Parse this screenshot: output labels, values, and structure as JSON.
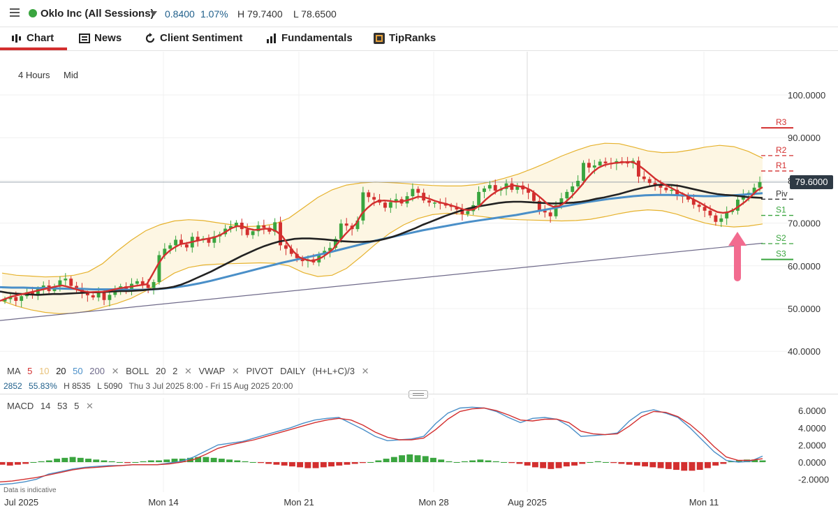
{
  "header": {
    "title": "Oklo Inc (All Sessions)",
    "change": "0.8400",
    "change_pct": "1.07%",
    "high": "H 79.7400",
    "low": "L 78.6500",
    "status_color": "#3aa53f"
  },
  "tabs": [
    {
      "label": "Chart",
      "icon": "candlestick-chart-icon"
    },
    {
      "label": "News",
      "icon": "news-icon"
    },
    {
      "label": "Client Sentiment",
      "icon": "refresh-icon"
    },
    {
      "label": "Fundamentals",
      "icon": "bar-chart-icon"
    },
    {
      "label": "TipRanks",
      "icon": "tipranks-icon"
    }
  ],
  "timeframe": {
    "interval": "4 Hours",
    "price_type": "Mid"
  },
  "legend": {
    "ma_label": "MA",
    "ma_periods": [
      "5",
      "10",
      "20",
      "50",
      "200"
    ],
    "boll_label": "BOLL",
    "boll_period": "20",
    "boll_dev": "2",
    "vwap_label": "VWAP",
    "pivot_label": "PIVOT",
    "pivot_type": "DAILY",
    "pivot_formula": "(H+L+C)/3",
    "close_x": "✕"
  },
  "stats": {
    "value": "2852",
    "pct": "55.83%",
    "high": "H 8535",
    "low": "L 5090",
    "range": "Thu 3 Jul 2025 8:00 - Fri 15 Aug 2025 20:00"
  },
  "macd_legend": {
    "label": "MACD",
    "fast": "14",
    "slow": "53",
    "signal": "5"
  },
  "disclaimer": "Data is indicative",
  "colors": {
    "up": "#3aa53f",
    "down": "#d32f2f",
    "ma5": "#d32f2f",
    "ma10": "#e8c27a",
    "ma20": "#222222",
    "ma50": "#4a8fc8",
    "ma200": "#6f6a8a",
    "boll": "#e6b22d",
    "price": "#1f5f8b"
  },
  "chart_data": [
    {
      "type": "candlestick",
      "title": "",
      "ylim": [
        35,
        105
      ],
      "yticks": [
        40,
        50,
        60,
        70,
        80,
        90,
        100
      ],
      "ytick_labels": [
        "40.0000",
        "50.0000",
        "60.0000",
        "70.0000",
        "80.0000",
        "90.0000",
        "100.0000"
      ],
      "x_labels": [
        "Jul 2025",
        "Mon 14",
        "Mon 21",
        "Mon 28",
        "Aug 2025",
        "Mon 11"
      ],
      "last_price": 79.6,
      "last_price_label": "79.6000",
      "close": [
        52.2,
        52.7,
        51.8,
        52.9,
        53.8,
        53.2,
        54.6,
        55.4,
        54.1,
        55.2,
        56.6,
        57.0,
        55.3,
        54.7,
        53.6,
        53.1,
        52.6,
        53.7,
        52.0,
        53.2,
        54.1,
        55.2,
        54.6,
        55.8,
        56.4,
        55.6,
        54.8,
        56.2,
        62.5,
        64.0,
        64.8,
        66.1,
        65.0,
        64.3,
        66.8,
        66.0,
        66.4,
        65.4,
        66.9,
        67.4,
        68.7,
        69.3,
        70.1,
        68.6,
        67.2,
        68.1,
        69.5,
        68.9,
        68.0,
        70.2,
        64.8,
        64.0,
        62.8,
        61.8,
        61.1,
        61.5,
        60.8,
        62.7,
        63.5,
        64.2,
        66.3,
        69.9,
        69.4,
        68.6,
        70.6,
        77.2,
        76.1,
        75.5,
        74.8,
        73.6,
        74.9,
        75.6,
        74.6,
        76.3,
        78.0,
        77.1,
        75.3,
        74.8,
        74.8,
        74.7,
        74.1,
        73.8,
        73.2,
        72.1,
        72.8,
        74.2,
        77.3,
        78.1,
        78.9,
        77.6,
        78.0,
        79.3,
        77.8,
        78.8,
        77.9,
        77.1,
        75.2,
        72.9,
        72.5,
        71.6,
        74.2,
        75.8,
        77.3,
        78.6,
        79.9,
        84.1,
        83.0,
        83.5,
        84.4,
        84.0,
        83.9,
        84.5,
        84.2,
        84.0,
        84.6,
        80.9,
        80.3,
        79.4,
        78.8,
        78.3,
        77.7,
        77.8,
        76.6,
        76.2,
        75.5,
        74.3,
        73.8,
        72.9,
        71.8,
        70.3,
        71.1,
        72.6,
        72.9,
        75.5,
        76.6,
        77.1,
        78.3,
        79.6
      ],
      "ma5": [
        51.8,
        52.3,
        52.8,
        53.1,
        53.4,
        53.7,
        54.0,
        54.3,
        54.6,
        54.9,
        55.2,
        55.4,
        55.1,
        54.7,
        54.3,
        54.0,
        53.8,
        53.9,
        53.9,
        54.1,
        54.4,
        54.7,
        54.9,
        55.1,
        55.3,
        55.5,
        55.7,
        58.0,
        60.4,
        62.3,
        63.5,
        64.4,
        65.1,
        65.3,
        65.6,
        65.9,
        66.2,
        66.4,
        66.7,
        67.2,
        68.0,
        68.8,
        69.3,
        69.2,
        68.7,
        68.4,
        68.5,
        68.7,
        68.6,
        68.0,
        66.9,
        65.0,
        63.3,
        62.0,
        61.5,
        61.2,
        61.4,
        62.0,
        62.9,
        64.0,
        65.6,
        67.2,
        68.6,
        69.8,
        72.1,
        73.5,
        74.6,
        75.2,
        75.3,
        75.2,
        75.0,
        75.1,
        75.3,
        75.7,
        76.2,
        76.1,
        75.7,
        75.2,
        74.8,
        74.5,
        74.1,
        73.7,
        73.2,
        73.0,
        73.3,
        74.2,
        75.5,
        76.6,
        77.5,
        78.1,
        78.6,
        78.8,
        78.6,
        78.3,
        77.7,
        76.7,
        75.6,
        74.4,
        73.8,
        74.0,
        74.8,
        76.0,
        77.4,
        78.9,
        80.6,
        82.0,
        83.0,
        83.6,
        83.9,
        84.1,
        84.2,
        84.3,
        84.3,
        83.6,
        82.6,
        81.5,
        80.4,
        79.5,
        78.8,
        78.1,
        77.4,
        76.8,
        76.1,
        75.4,
        74.7,
        73.9,
        73.2,
        72.6,
        72.4,
        72.6,
        73.2,
        74.1,
        75.1,
        76.3,
        77.6,
        78.4
      ],
      "ma20": [
        54.0,
        53.7,
        53.5,
        53.4,
        53.3,
        53.2,
        53.3,
        53.4,
        53.4,
        53.5,
        53.6,
        53.7,
        53.8,
        53.8,
        53.9,
        54.0,
        54.1,
        54.1,
        54.2,
        54.3,
        54.5,
        54.6,
        54.8,
        55.1,
        55.6,
        56.3,
        57.1,
        57.9,
        58.7,
        59.6,
        60.5,
        61.4,
        62.3,
        63.1,
        63.9,
        64.6,
        65.2,
        65.7,
        66.0,
        66.3,
        66.4,
        66.4,
        66.3,
        66.2,
        66.0,
        65.8,
        65.7,
        65.6,
        65.6,
        65.7,
        65.9,
        66.3,
        66.8,
        67.4,
        68.1,
        68.8,
        69.6,
        70.3,
        71.0,
        71.7,
        72.3,
        72.9,
        73.4,
        73.8,
        74.1,
        74.4,
        74.7,
        74.9,
        75.0,
        75.0,
        74.9,
        74.8,
        74.7,
        74.6,
        74.6,
        74.7,
        74.8,
        75.0,
        75.3,
        75.7,
        76.0,
        76.4,
        76.8,
        77.3,
        77.8,
        78.2,
        78.6,
        78.9,
        79.0,
        78.9,
        78.7,
        78.3,
        77.9,
        77.5,
        77.1,
        76.8,
        76.6,
        76.5,
        76.3,
        76.1,
        76.0,
        75.9
      ],
      "ma50": [
        55.0,
        54.9,
        54.9,
        54.8,
        54.8,
        54.7,
        54.6,
        54.6,
        54.5,
        54.5,
        54.5,
        54.4,
        54.4,
        54.5,
        54.7,
        55.0,
        55.4,
        55.9,
        56.5,
        57.2,
        57.9,
        58.6,
        59.3,
        60.0,
        60.7,
        61.3,
        61.9,
        62.5,
        63.1,
        63.8,
        64.5,
        65.2,
        65.9,
        66.5,
        67.1,
        67.7,
        68.3,
        68.8,
        69.3,
        69.8,
        70.3,
        70.7,
        71.1,
        71.5,
        71.9,
        72.4,
        72.9,
        73.4,
        73.9,
        74.4,
        74.9,
        75.3,
        75.7,
        76.0,
        76.3,
        76.5,
        76.6,
        76.6,
        76.5,
        76.4,
        76.3,
        76.3,
        76.4,
        76.6,
        76.8,
        77.0
      ],
      "ma200": [
        47.2,
        65.3
      ],
      "boll_upper": [
        58.3,
        57.8,
        57.6,
        57.4,
        57.5,
        57.8,
        58.6,
        60.5,
        63.4,
        66.0,
        68.2,
        69.6,
        70.5,
        70.8,
        70.6,
        70.1,
        69.6,
        69.2,
        69.3,
        69.8,
        71.2,
        73.6,
        76.0,
        77.8,
        78.9,
        79.4,
        79.6,
        79.5,
        79.3,
        79.0,
        78.8,
        78.7,
        78.7,
        79.0,
        79.6,
        80.5,
        81.5,
        82.8,
        84.2,
        85.7,
        87.0,
        88.1,
        88.7,
        88.6,
        87.8,
        86.9,
        86.5,
        86.6,
        87.1,
        87.8,
        88.2,
        87.9,
        86.8,
        85.2
      ],
      "boll_lower": [
        51.8,
        50.6,
        49.7,
        49.1,
        48.8,
        48.9,
        49.4,
        50.3,
        51.2,
        52.4,
        54.1,
        56.2,
        58.3,
        59.6,
        60.2,
        60.4,
        60.5,
        60.6,
        60.7,
        60.6,
        60.0,
        58.4,
        57.5,
        57.8,
        59.4,
        62.1,
        65.0,
        67.6,
        69.6,
        71.1,
        72.0,
        72.3,
        72.1,
        71.7,
        71.3,
        71.0,
        70.8,
        70.7,
        70.6,
        70.5,
        70.6,
        70.9,
        71.5,
        72.2,
        72.8,
        73.1,
        72.9,
        72.1,
        71.0,
        70.0,
        69.4,
        69.1,
        69.3,
        69.8
      ],
      "pivot_levels": [
        {
          "label": "R3",
          "value": 92.3
        },
        {
          "label": "R2",
          "value": 85.8
        },
        {
          "label": "R1",
          "value": 82.2
        },
        {
          "label": "Piv",
          "value": 75.6
        },
        {
          "label": "S1",
          "value": 71.8
        },
        {
          "label": "S2",
          "value": 65.2
        },
        {
          "label": "S3",
          "value": 61.5
        }
      ]
    },
    {
      "type": "bar",
      "title": "MACD",
      "ylim": [
        -3,
        7
      ],
      "yticks": [
        -2,
        0,
        2,
        4,
        6
      ],
      "ytick_labels": [
        "-2.0000",
        "0.0000",
        "2.0000",
        "4.0000",
        "6.0000"
      ],
      "macd": [
        -2.6,
        -2.5,
        -2.3,
        -2.0,
        -1.4,
        -1.1,
        -0.8,
        -0.6,
        -0.5,
        -0.4,
        -0.4,
        -0.3,
        -0.3,
        -0.3,
        -0.1,
        0.1,
        0.6,
        1.3,
        2.0,
        2.2,
        2.4,
        2.8,
        3.2,
        3.6,
        4.0,
        4.5,
        4.9,
        5.1,
        5.2,
        4.5,
        3.8,
        3.0,
        2.5,
        2.6,
        2.7,
        3.0,
        4.5,
        5.7,
        6.3,
        6.4,
        6.3,
        5.9,
        5.2,
        4.6,
        5.1,
        5.2,
        5.0,
        4.2,
        3.0,
        3.1,
        3.2,
        3.4,
        4.8,
        5.8,
        6.1,
        5.7,
        5.2,
        4.0,
        2.6,
        1.2,
        0.2,
        0.0,
        0.1,
        0.7
      ],
      "signal": [
        -2.3,
        -2.2,
        -2.0,
        -1.8,
        -1.5,
        -1.2,
        -0.9,
        -0.7,
        -0.6,
        -0.5,
        -0.4,
        -0.3,
        -0.3,
        -0.3,
        -0.2,
        0.0,
        0.3,
        0.9,
        1.6,
        2.0,
        2.3,
        2.6,
        3.0,
        3.4,
        3.8,
        4.2,
        4.6,
        4.9,
        5.1,
        4.9,
        4.3,
        3.5,
        2.9,
        2.6,
        2.6,
        2.8,
        3.8,
        5.0,
        5.9,
        6.2,
        6.3,
        6.0,
        5.5,
        4.9,
        4.8,
        5.0,
        5.0,
        4.6,
        3.6,
        3.3,
        3.2,
        3.3,
        4.2,
        5.3,
        5.9,
        5.8,
        5.3,
        4.4,
        3.2,
        1.8,
        0.6,
        0.2,
        0.2,
        0.4
      ],
      "histogram": [
        -0.3,
        -0.4,
        -0.3,
        -0.2,
        0.0,
        0.1,
        0.2,
        0.4,
        0.5,
        0.6,
        0.5,
        0.4,
        0.3,
        0.2,
        0.1,
        0.0,
        -0.1,
        0.0,
        0.1,
        0.2,
        0.2,
        0.3,
        0.4,
        0.4,
        0.5,
        0.6,
        0.6,
        0.5,
        0.4,
        0.3,
        0.2,
        0.1,
        0.0,
        -0.1,
        -0.2,
        -0.3,
        -0.4,
        -0.5,
        -0.6,
        -0.7,
        -0.7,
        -0.6,
        -0.5,
        -0.4,
        -0.3,
        -0.2,
        -0.1,
        0.0,
        0.2,
        0.4,
        0.6,
        0.8,
        0.9,
        0.8,
        0.7,
        0.5,
        0.3,
        0.1,
        0.0,
        0.1,
        0.2,
        0.3,
        0.2,
        0.1,
        0.0,
        -0.1,
        -0.2,
        -0.4,
        -0.6,
        -0.7,
        -0.8,
        -0.7,
        -0.5,
        -0.4,
        -0.2,
        0.0,
        0.1,
        0.0,
        -0.1,
        -0.2,
        -0.3,
        -0.4,
        -0.5,
        -0.6,
        -0.7,
        -0.8,
        -0.9,
        -1.0,
        -1.0,
        -0.9,
        -0.7,
        -0.4,
        -0.2,
        0.1,
        0.2,
        0.3,
        0.3,
        0.2
      ]
    }
  ]
}
